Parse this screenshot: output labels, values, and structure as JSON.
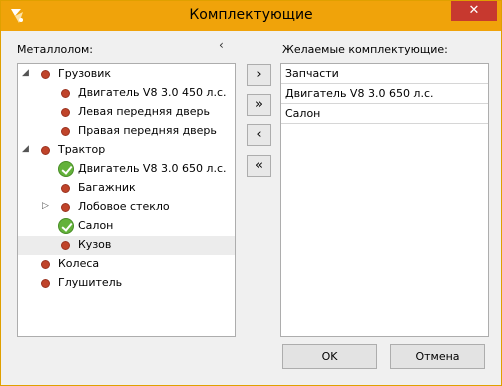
{
  "window": {
    "title": "Комплектующие",
    "close_label": "✕"
  },
  "left_panel": {
    "label": "Металлолом:",
    "collapse_glyph": "‹",
    "tree": [
      {
        "text": "Грузовик",
        "level": 0,
        "icon": "red-dot-icon",
        "expander": "expanded"
      },
      {
        "text": "Двигатель V8 3.0 450 л.с.",
        "level": 1,
        "icon": "red-dot-icon"
      },
      {
        "text": "Левая передняя дверь",
        "level": 1,
        "icon": "red-dot-icon"
      },
      {
        "text": "Правая передняя дверь",
        "level": 1,
        "icon": "red-dot-icon"
      },
      {
        "text": "Трактор",
        "level": 0,
        "icon": "red-dot-icon",
        "expander": "expanded"
      },
      {
        "text": "Двигатель V8 3.0 650 л.с.",
        "level": 1,
        "icon": "check-icon"
      },
      {
        "text": "Багажник",
        "level": 1,
        "icon": "red-dot-icon"
      },
      {
        "text": "Лобовое стекло",
        "level": 1,
        "icon": "red-dot-icon",
        "expander": "collapsed"
      },
      {
        "text": "Салон",
        "level": 1,
        "icon": "check-icon"
      },
      {
        "text": "Кузов",
        "level": 1,
        "icon": "red-dot-icon",
        "selected": true
      },
      {
        "text": "Колеса",
        "level": 0,
        "icon": "red-dot-icon"
      },
      {
        "text": "Глушитель",
        "level": 0,
        "icon": "red-dot-icon"
      }
    ]
  },
  "move_buttons": {
    "move_right": "›",
    "move_all_right": "»",
    "move_left": "‹",
    "move_all_left": "«"
  },
  "right_panel": {
    "label": "Желаемые комплектующие:",
    "items": [
      "Запчасти",
      "Двигатель V8 3.0 650 л.с.",
      "Салон"
    ]
  },
  "buttons": {
    "ok": "OK",
    "cancel": "Отмена"
  },
  "colors": {
    "titlebar": "#f0a30a",
    "close": "#c7392f",
    "dot": "#c0442a",
    "check": "#63b23a"
  }
}
